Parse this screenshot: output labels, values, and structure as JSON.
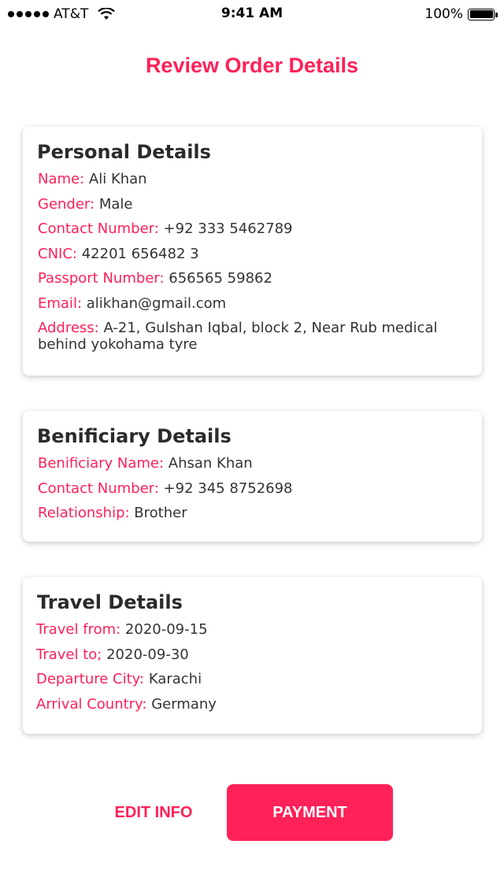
{
  "status_bar": {
    "carrier": "AT&T",
    "time": "9:41 AM",
    "battery": "100%"
  },
  "page": {
    "title": "Review Order Details"
  },
  "personal": {
    "heading": "Personal Details",
    "rows": [
      {
        "label": "Name:",
        "value": "Ali Khan"
      },
      {
        "label": "Gender:",
        "value": "Male"
      },
      {
        "label": "Contact Number:",
        "value": "+92 333 5462789"
      },
      {
        "label": "CNIC:",
        "value": "42201 656482 3"
      },
      {
        "label": "Passport Number:",
        "value": "656565 59862"
      },
      {
        "label": "Email:",
        "value": "alikhan@gmail.com"
      },
      {
        "label": "Address:",
        "value": "A-21, Gulshan Iqbal, block 2, Near Rub medical behind yokohama tyre"
      }
    ]
  },
  "beneficiary": {
    "heading": "Benificiary Details",
    "rows": [
      {
        "label": "Benificiary Name:",
        "value": "Ahsan Khan"
      },
      {
        "label": "Contact Number:",
        "value": "+92 345 8752698"
      },
      {
        "label": "Relationship:",
        "value": "Brother"
      }
    ]
  },
  "travel": {
    "heading": "Travel Details",
    "rows": [
      {
        "label": "Travel from:",
        "value": "2020-09-15"
      },
      {
        "label": "Travel to;",
        "value": "2020-09-30"
      },
      {
        "label": "Departure City:",
        "value": "Karachi"
      },
      {
        "label": "Arrival Country:",
        "value": "Germany"
      }
    ]
  },
  "actions": {
    "edit_label": "EDIT INFO",
    "payment_label": "PAYMENT"
  },
  "colors": {
    "accent": "#ff2158",
    "text": "#333333"
  }
}
